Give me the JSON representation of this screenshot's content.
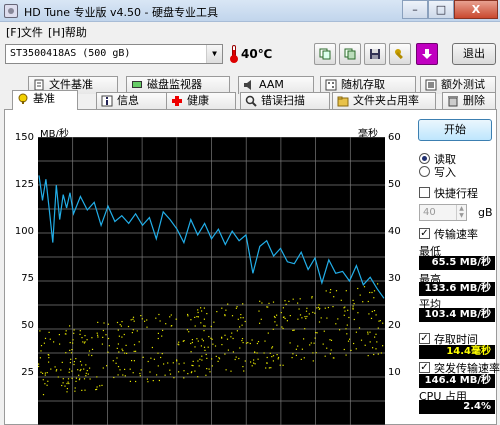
{
  "window": {
    "title": "HD Tune 专业版 v4.50 - 硬盘专业工具",
    "min": "–",
    "max": "□",
    "close": "X"
  },
  "menu": {
    "file": "[F]文件",
    "help": "[H]帮助"
  },
  "toolbar": {
    "drive": "ST3500418AS (500 gB)",
    "temperature": "40℃",
    "exit": "退出"
  },
  "tabs_top": [
    {
      "label": "文件基准",
      "icon": "file-benchmark-icon"
    },
    {
      "label": "磁盘监视器",
      "icon": "disk-monitor-icon"
    },
    {
      "label": "AAM",
      "icon": "speaker-icon"
    },
    {
      "label": "随机存取",
      "icon": "random-access-icon"
    },
    {
      "label": "额外测试",
      "icon": "extra-tests-icon"
    }
  ],
  "tabs_bottom": [
    {
      "label": "基准",
      "icon": "benchmark-icon",
      "active": true
    },
    {
      "label": "信息",
      "icon": "info-icon"
    },
    {
      "label": "健康",
      "icon": "health-icon"
    },
    {
      "label": "错误扫描",
      "icon": "error-scan-icon"
    },
    {
      "label": "文件夹占用率",
      "icon": "folder-usage-icon"
    },
    {
      "label": "删除",
      "icon": "erase-icon"
    }
  ],
  "side": {
    "start": "开始",
    "read": "读取",
    "write": "写入",
    "short_stroke": "快捷行程",
    "short_stroke_value": "40",
    "gb": "gB",
    "transfer_rate": "传输速率",
    "min_label": "最低",
    "min_value": "65.5 MB/秒",
    "max_label": "最高",
    "max_value": "133.6 MB/秒",
    "avg_label": "平均",
    "avg_value": "103.4 MB/秒",
    "access_time": "存取时间",
    "access_value": "14.4毫秒",
    "burst": "突发传输速率",
    "burst_value": "146.4 MB/秒",
    "cpu": "CPU 占用",
    "cpu_value": "2.4%"
  },
  "colors": {
    "plot_bg": "#000000",
    "grid": "#7a7a7a",
    "transfer": "#22aee8",
    "access": "#e6e600"
  },
  "chart_data": {
    "type": "line",
    "y_left_unit": "MB/秒",
    "y_right_unit": "毫秒",
    "y_left_ticks": [
      150,
      125,
      100,
      75,
      50,
      25
    ],
    "y_right_ticks": [
      60,
      50,
      40,
      30,
      20,
      10
    ],
    "ylim_left": [
      0,
      150
    ],
    "ylim_right": [
      0,
      60
    ],
    "grid": true,
    "series": [
      {
        "kind": "line",
        "axis": "left",
        "x": [
          0,
          1,
          2,
          3,
          4,
          5,
          6,
          7,
          8,
          9,
          10,
          12,
          14,
          16,
          18,
          20,
          22,
          24,
          26,
          28,
          30,
          32,
          34,
          36,
          38,
          40,
          42,
          44,
          46,
          48,
          50,
          52,
          54,
          56,
          58,
          60,
          62,
          64,
          66,
          68,
          70,
          72,
          74,
          76,
          78,
          80,
          82,
          84,
          86,
          88,
          90,
          92,
          94,
          96,
          98,
          100
        ],
        "y": [
          130,
          117,
          128,
          112,
          95,
          125,
          107,
          120,
          113,
          121,
          110,
          119,
          112,
          116,
          104,
          114,
          106,
          109,
          105,
          110,
          104,
          108,
          97,
          111,
          107,
          102,
          95,
          107,
          99,
          105,
          97,
          102,
          94,
          101,
          96,
          99,
          79,
          93,
          96,
          88,
          92,
          85,
          84,
          90,
          81,
          87,
          74,
          86,
          79,
          80,
          75,
          83,
          73,
          77,
          71,
          66
        ]
      },
      {
        "kind": "scatter",
        "axis": "right",
        "note": "access time samples",
        "x_range": [
          0,
          100
        ],
        "y_band_start": [
          6,
          20
        ],
        "y_band_end": [
          15,
          30
        ]
      }
    ]
  }
}
